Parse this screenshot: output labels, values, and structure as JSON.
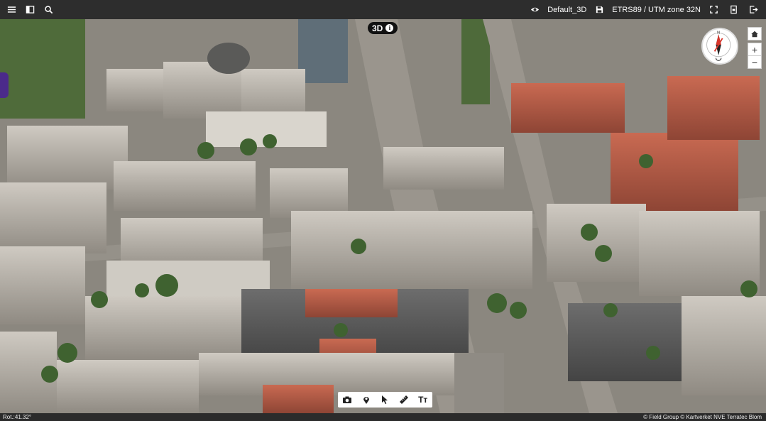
{
  "topbar": {
    "view_name": "Default_3D",
    "crs": "ETRS89 / UTM zone 32N"
  },
  "map": {
    "mode_badge": "3D",
    "info_glyph": "i"
  },
  "nav": {
    "zoom_in": "+",
    "zoom_out": "−"
  },
  "toolbar": {
    "text_tool": "Tт"
  },
  "status": {
    "rotation": "Rot.:41.32°",
    "attribution": "© Field Group © Kartverket NVE Terratec Blom"
  },
  "icons": [
    "menu-icon",
    "panel-icon",
    "search-icon",
    "eye-icon",
    "save-icon",
    "fullscreen-icon",
    "print-icon",
    "logout-icon",
    "home-icon",
    "compass-icon",
    "camera-icon",
    "location-pin-icon",
    "pointer-icon",
    "ruler-icon",
    "text-icon"
  ]
}
